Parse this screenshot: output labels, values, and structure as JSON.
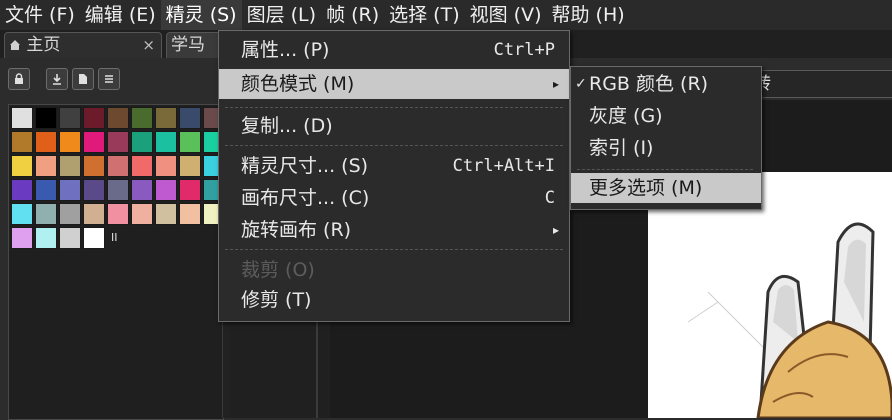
{
  "menubar": {
    "items": [
      {
        "label": "文件 (F)"
      },
      {
        "label": "编辑 (E)"
      },
      {
        "label": "精灵 (S)"
      },
      {
        "label": "图层 (L)"
      },
      {
        "label": "帧 (R)"
      },
      {
        "label": "选择 (T)"
      },
      {
        "label": "视图 (V)"
      },
      {
        "label": "帮助 (H)"
      }
    ],
    "active": "精灵 (S)"
  },
  "tabs": {
    "home_icon": "home-icon",
    "home_label": "主页",
    "close_glyph": "×",
    "doc_label": "学马"
  },
  "toolbar_icons": [
    "lock-icon",
    "download-icon",
    "file-icon",
    "menu-icon"
  ],
  "palette": {
    "colors": [
      [
        "#e0e0e0",
        "#000000",
        "#404040",
        "#6b1b2a",
        "#6d4a2f",
        "#4a6b2e",
        "#7a6a3a",
        "#3a4a6a",
        "#6a4a4a"
      ],
      [
        "#b07a2a",
        "#e0601a",
        "#f08a1a",
        "#e01a7a",
        "#9a3a5a",
        "#1aa07a",
        "#1ac0a0",
        "#5ac05a",
        "#1ad0a0"
      ],
      [
        "#f0d040",
        "#f0a080",
        "#b0a070",
        "#d07030",
        "#d07070",
        "#f06a6a",
        "#f09080",
        "#d0b070",
        "#3ad0e0"
      ],
      [
        "#6a3ac0",
        "#3a5ab0",
        "#7070c0",
        "#5a4a8a",
        "#6a6a8a",
        "#8a5ac0",
        "#c05ad0",
        "#e02a6a",
        "#30a0a0"
      ],
      [
        "#60e0f0",
        "#90b0b0",
        "#a0a0a0",
        "#d0b090",
        "#f090a0",
        "#f0b0a0",
        "#d0c0a0",
        "#f0c0a0",
        "#f0f0c0"
      ],
      [
        "#e0a0f0",
        "#b0f0f0",
        "#d0d0d0",
        "#ffffff"
      ]
    ],
    "marker": "II"
  },
  "sprite_menu": {
    "items": [
      {
        "label": "属性... (P)",
        "shortcut": "Ctrl+P",
        "submenu": false,
        "disabled": false
      },
      {
        "label": "颜色模式 (M)",
        "shortcut": "",
        "submenu": true,
        "highlight": true,
        "disabled": false
      },
      {
        "label": "复制... (D)",
        "shortcut": "",
        "submenu": false,
        "disabled": false
      },
      {
        "label": "精灵尺寸... (S)",
        "shortcut": "Ctrl+Alt+I",
        "submenu": false,
        "disabled": false
      },
      {
        "label": "画布尺寸... (C)",
        "shortcut": "C",
        "submenu": false,
        "disabled": false
      },
      {
        "label": "旋转画布 (R)",
        "shortcut": "",
        "submenu": true,
        "disabled": false
      },
      {
        "label": "裁剪 (O)",
        "shortcut": "",
        "submenu": false,
        "disabled": true
      },
      {
        "label": "修剪 (T)",
        "shortcut": "",
        "submenu": false,
        "disabled": false
      }
    ],
    "arrow_glyph": "▸"
  },
  "color_submenu": {
    "items": [
      {
        "label": "RGB 颜色 (R)",
        "checked": true
      },
      {
        "label": "灰度 (G)",
        "checked": false
      },
      {
        "label": "索引 (I)",
        "checked": false
      },
      {
        "label": "更多选项 (M)",
        "checked": false,
        "highlight": true
      }
    ],
    "check_glyph": "✓"
  },
  "mode_box": {
    "text": "转"
  },
  "canvas": {
    "description_icon": "bunny-girl-sprite"
  }
}
